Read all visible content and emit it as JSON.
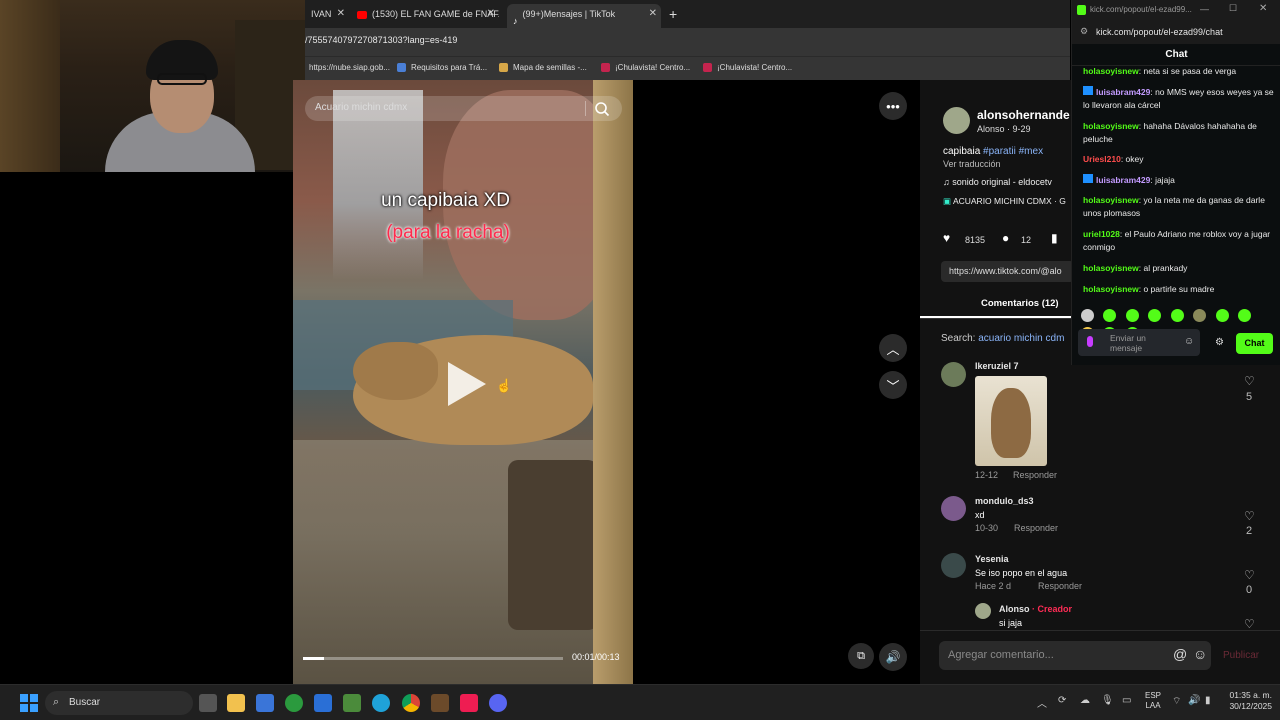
{
  "browser": {
    "tabs": [
      {
        "label": "IVAN",
        "active": false
      },
      {
        "label": "(1530) EL FAN GAME de FNAF...",
        "active": false
      },
      {
        "label": "(99+)Mensajes | TikTok",
        "active": true
      }
    ],
    "new_tab_label": "+",
    "address": "/7555740797270871303?lang=es-419",
    "bookmarks": [
      "https://nube.siap.gob...",
      "Requisitos para Trá...",
      "Mapa de semillas -...",
      "¡Chulavista! Centro...",
      "¡Chulavista! Centro..."
    ]
  },
  "video": {
    "search_placeholder": "Acuario michin cdmx",
    "caption_line1": "un capibaia XD",
    "caption_line2": "(para la racha)",
    "time": "00:01/00:13",
    "progress_fraction": 0.08
  },
  "post": {
    "username": "alonsohernande",
    "subtitle": "Alonso · 9-29",
    "description": "capibaia",
    "hashtags": "#paratii #mex",
    "translate": "Ver traducción",
    "sound": "sonido original - eldocetv",
    "location": "ACUARIO MICHIN CDMX · G",
    "likes": "8135",
    "comments_count": "12",
    "link": "https://www.tiktok.com/@alo",
    "comments_tab": "Comentarios (12)",
    "search_label": "Search:",
    "search_term": "acuario michin cdm",
    "more_icon": "more-horizontal-icon"
  },
  "comments": [
    {
      "name": "Ikeruziel 7",
      "text": "",
      "date": "12-12",
      "reply": "Responder",
      "likes": "5"
    },
    {
      "name": "mondulo_ds3",
      "text": "xd",
      "date": "10-30",
      "reply": "Responder",
      "likes": "2"
    },
    {
      "name": "Yesenia",
      "text": "Se iso popo en el agua",
      "date": "Hace 2 d",
      "reply": "Responder",
      "likes": "0"
    },
    {
      "name": "Alonso",
      "creator": "· Creador",
      "text": "si jaja"
    }
  ],
  "comment_input": {
    "placeholder": "Agregar comentario...",
    "mention": "@",
    "post_label": "Publicar"
  },
  "kick": {
    "window_title": "kick.com/popout/el-ezad99...",
    "url": "kick.com/popout/el-ezad99/chat",
    "chat_title": "Chat",
    "messages": [
      {
        "user": "holasoyisnew",
        "color": "green",
        "text": ": neta si se pasa de verga"
      },
      {
        "user": "luisabram429",
        "color": "purple",
        "text": ": no MMS wey esos weyes ya se lo llevaron ala cárcel"
      },
      {
        "user": "holasoyisnew",
        "color": "green",
        "text": ": hahaha Dávalos hahahaha de peluche"
      },
      {
        "user": "Uriesl210",
        "color": "red",
        "text": ": okey"
      },
      {
        "user": "luisabram429",
        "color": "purple",
        "text": ": jajaja"
      },
      {
        "user": "holasoyisnew",
        "color": "green",
        "text": ": yo la neta me da ganas de darle unos plomasos"
      },
      {
        "user": "uriel1028",
        "color": "green",
        "text": ": el Paulo Adriano me roblox voy a jugar conmigo"
      },
      {
        "user": "holasoyisnew",
        "color": "green",
        "text": ": al prankady"
      },
      {
        "user": "holasoyisnew",
        "color": "green",
        "text": ": o partirle su madre"
      }
    ],
    "input_placeholder": "Enviar un mensaje",
    "send_label": "Chat",
    "accent": "#53fc18"
  },
  "taskbar": {
    "search_label": "Buscar",
    "lang": "ESP",
    "lang2": "LAA",
    "time": "01:35 a. m.",
    "date": "30/12/2025"
  }
}
